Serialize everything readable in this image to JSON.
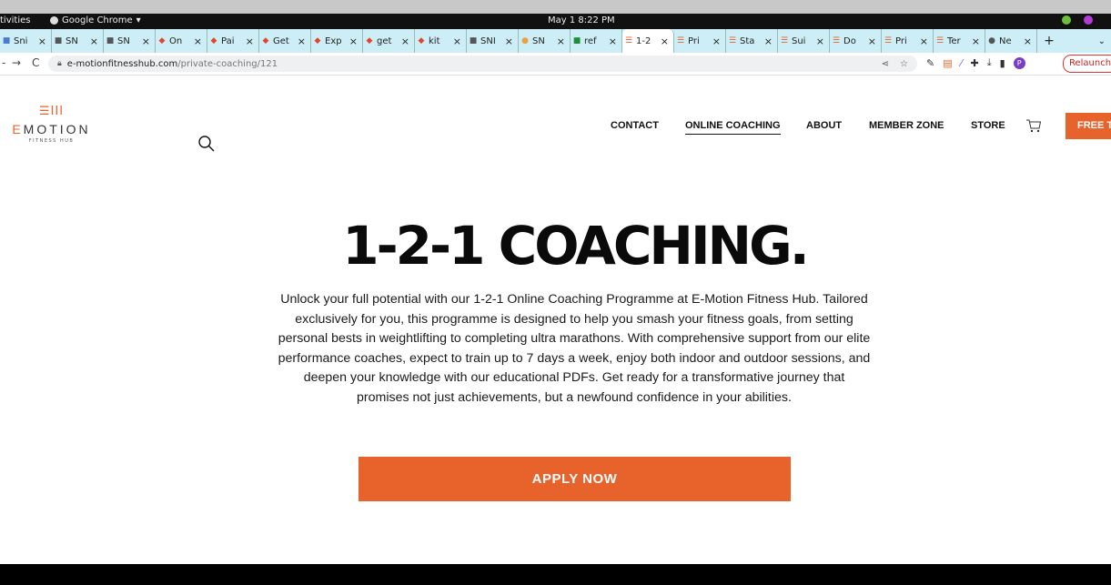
{
  "system": {
    "activities": "tivities",
    "app": "Google Chrome",
    "clock": "May 1   8:22 PM"
  },
  "tabs": [
    {
      "label": "Sni",
      "icon": "snip-icon",
      "color": "#4a7bd0"
    },
    {
      "label": "SN",
      "icon": "doc-icon",
      "color": "#555"
    },
    {
      "label": "SN",
      "icon": "doc-icon",
      "color": "#555"
    },
    {
      "label": "On",
      "icon": "gitlab-icon",
      "color": "#e24329"
    },
    {
      "label": "Pai",
      "icon": "gitlab-icon",
      "color": "#e24329"
    },
    {
      "label": "Get",
      "icon": "gitlab-icon",
      "color": "#e24329"
    },
    {
      "label": "Exp",
      "icon": "gitlab-icon",
      "color": "#e24329"
    },
    {
      "label": "get",
      "icon": "gitlab-icon",
      "color": "#e24329"
    },
    {
      "label": "kit",
      "icon": "gitlab-icon",
      "color": "#e24329"
    },
    {
      "label": "SNI",
      "icon": "doc-icon",
      "color": "#555"
    },
    {
      "label": "SN",
      "icon": "chrome-icon",
      "color": "#e8a33d"
    },
    {
      "label": "ref",
      "icon": "sheet-icon",
      "color": "#1e8e3e"
    },
    {
      "label": "1-2",
      "icon": "emotion-icon",
      "color": "#e8632b",
      "active": true
    },
    {
      "label": "Pri",
      "icon": "emotion-icon",
      "color": "#e8632b"
    },
    {
      "label": "Sta",
      "icon": "emotion-icon",
      "color": "#e8632b"
    },
    {
      "label": "Sui",
      "icon": "emotion-icon",
      "color": "#e8632b"
    },
    {
      "label": "Do",
      "icon": "emotion-icon",
      "color": "#e8632b"
    },
    {
      "label": "Pri",
      "icon": "emotion-icon",
      "color": "#e8632b"
    },
    {
      "label": "Ter",
      "icon": "emotion-icon",
      "color": "#e8632b"
    },
    {
      "label": "Ne",
      "icon": "chrome-icon",
      "color": "#555"
    }
  ],
  "address": {
    "domain": "e-motionfitnesshub.com",
    "path": "/private-coaching/121",
    "relaunch": "Relaunch",
    "profile": "P"
  },
  "site": {
    "logo_mark": "☰III",
    "logo_word_first": "E",
    "logo_word_rest": "MOTION",
    "logo_sub": "FITNESS HUB",
    "nav": [
      "CONTACT",
      "ONLINE COACHING",
      "ABOUT",
      "MEMBER ZONE",
      "STORE"
    ],
    "free_button": "FREE TRIAL",
    "accent": "#e8632b"
  },
  "hero": {
    "title": "1-2-1 COACHING.",
    "body": "Unlock your full potential with our 1-2-1 Online Coaching Programme at E-Motion Fitness Hub. Tailored exclusively for you, this programme is designed to help you smash your fitness goals, from setting personal bests in weightlifting to completing ultra marathons. With comprehensive support from our elite performance coaches, expect to train up to 7 days a week, enjoy both indoor and outdoor sessions, and deepen your knowledge with our educational PDFs. Get ready for a transformative journey that promises not just achievements, but a newfound confidence in your abilities.",
    "cta": "APPLY NOW"
  }
}
